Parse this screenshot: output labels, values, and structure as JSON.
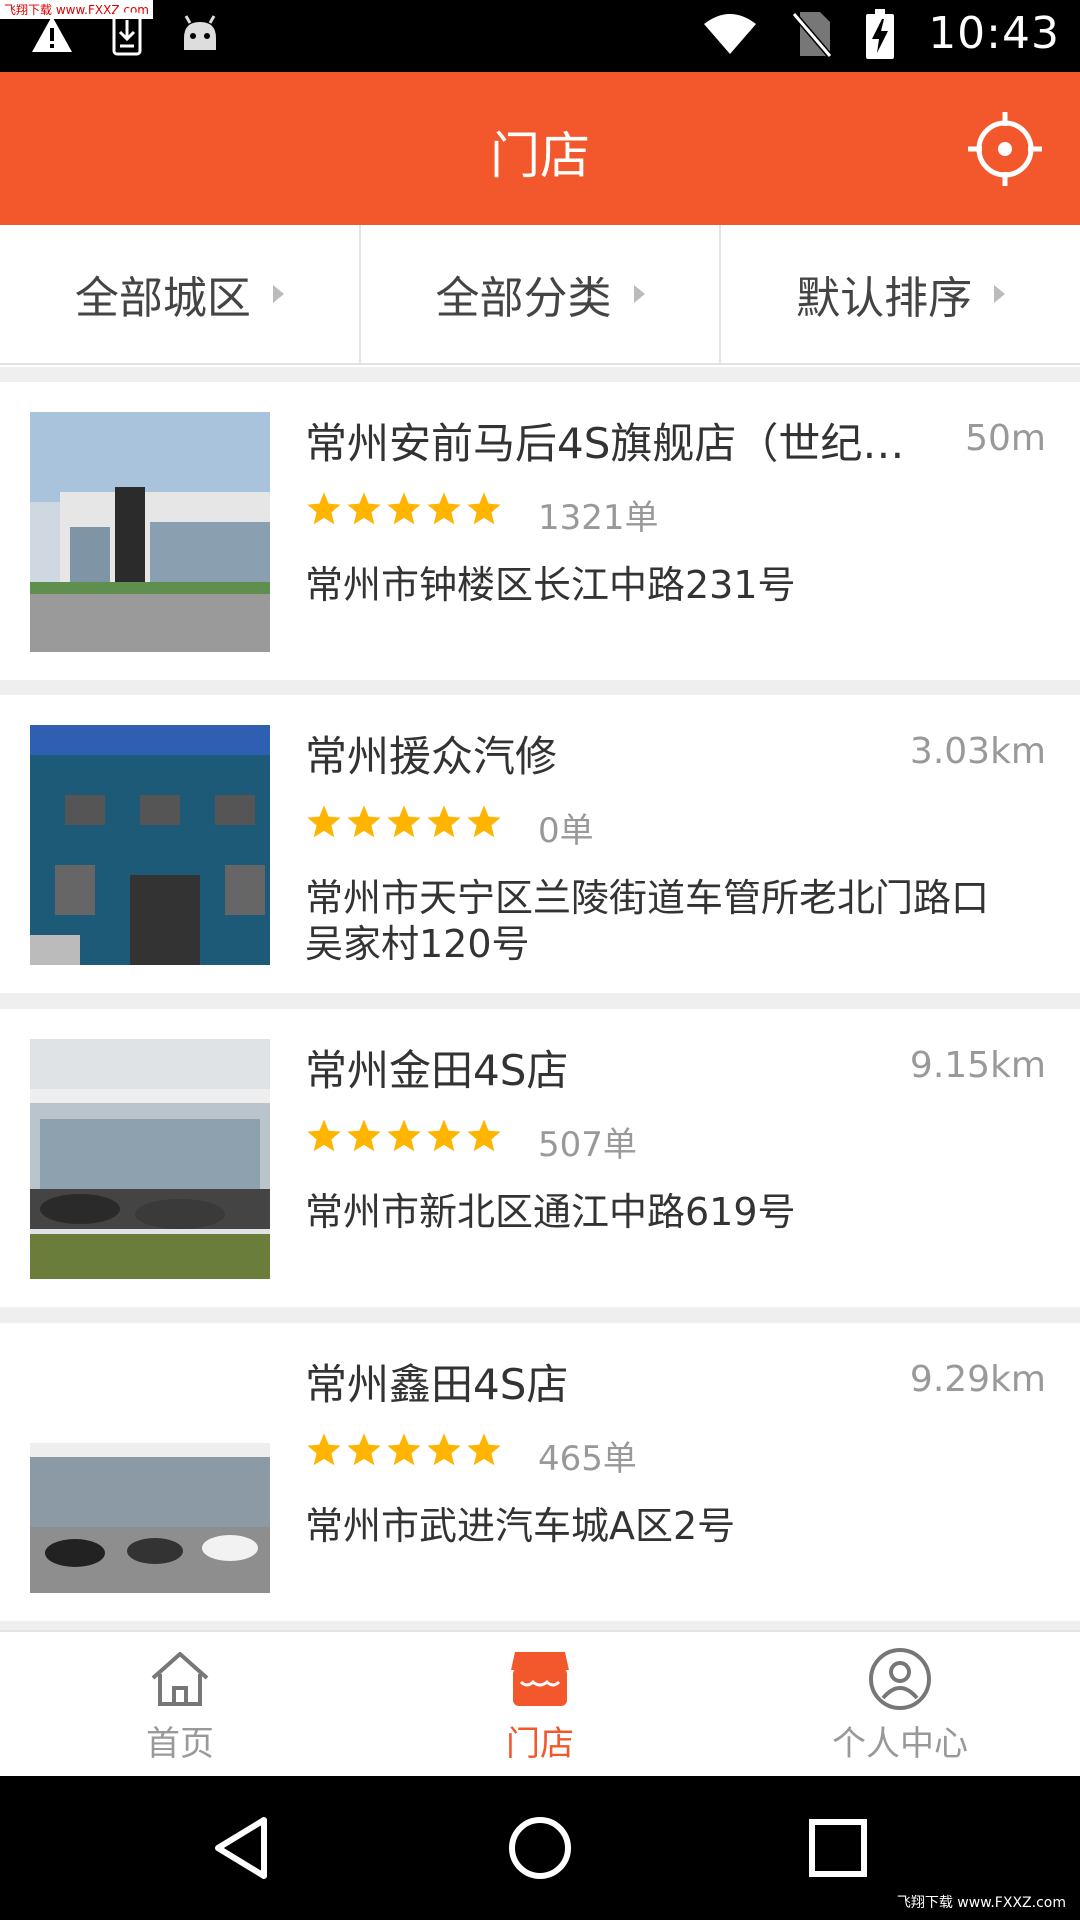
{
  "status_bar": {
    "time": "10:43",
    "watermark": "飞翔下载 www.FXXZ.com",
    "icons": [
      "warning-icon",
      "download-icon",
      "android-icon",
      "wifi-icon",
      "no-sim-icon",
      "battery-charging-icon"
    ]
  },
  "header": {
    "title": "门店",
    "locate_icon": "locate-icon"
  },
  "filters": [
    {
      "label": "全部城区"
    },
    {
      "label": "全部分类"
    },
    {
      "label": "默认排序"
    }
  ],
  "shops": [
    {
      "name": "常州安前马后4S旗舰店（世纪…",
      "distance": "50m",
      "rating": 5,
      "orders": "1321单",
      "address": "常州市钟楼区长江中路231号"
    },
    {
      "name": "常州援众汽修",
      "distance": "3.03km",
      "rating": 5,
      "orders": "0单",
      "address": "常州市天宁区兰陵街道车管所老北门路口吴家村120号"
    },
    {
      "name": "常州金田4S店",
      "distance": "9.15km",
      "rating": 5,
      "orders": "507单",
      "address": "常州市新北区通江中路619号"
    },
    {
      "name": "常州鑫田4S店",
      "distance": "9.29km",
      "rating": 5,
      "orders": "465单",
      "address": "常州市武进汽车城A区2号"
    }
  ],
  "tabs": [
    {
      "label": "首页",
      "icon": "home-icon",
      "active": false
    },
    {
      "label": "门店",
      "icon": "store-icon",
      "active": true
    },
    {
      "label": "个人中心",
      "icon": "user-icon",
      "active": false
    }
  ],
  "theme": {
    "accent": "#f2582b",
    "star": "#ffb400"
  },
  "bottom_watermark": "飞翔下载 www.FXXZ.com"
}
